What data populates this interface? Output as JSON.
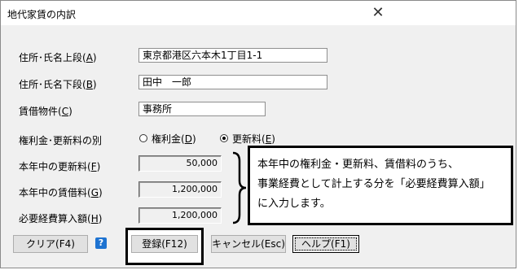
{
  "window": {
    "title": "地代家賃の内訳",
    "close_icon": "close-icon"
  },
  "fields": {
    "address_upper": {
      "label_pre": "住所･氏名上段(",
      "label_key": "A",
      "label_post": ")",
      "value": "東京都港区六本木1丁目1-1"
    },
    "address_lower": {
      "label_pre": "住所･氏名下段(",
      "label_key": "B",
      "label_post": ")",
      "value": "田中　一郎"
    },
    "property": {
      "label_pre": "賃借物件(",
      "label_key": "C",
      "label_post": ")",
      "value": "事務所"
    }
  },
  "type_choice": {
    "label": "権利金･更新料の別",
    "option1": {
      "pre": "権利金(",
      "key": "D",
      "post": ")",
      "selected": false
    },
    "option2": {
      "pre": "更新料(",
      "key": "E",
      "post": ")",
      "selected": true
    }
  },
  "amounts": {
    "renewal": {
      "label_pre": "本年中の更新料(",
      "label_key": "F",
      "label_post": ")",
      "value": "50,000"
    },
    "rent": {
      "label_pre": "本年中の賃借料(",
      "label_key": "G",
      "label_post": ")",
      "value": "1,200,000"
    },
    "expense": {
      "label_pre": "必要経費算入額(",
      "label_key": "H",
      "label_post": ")",
      "value": "1,200,000"
    }
  },
  "buttons": {
    "clear": "クリア(F4)",
    "help_icon": "?",
    "register": "登録(F12)",
    "cancel": "キャンセル(Esc)",
    "help": "ヘルプ(F1)"
  },
  "note": {
    "line1": "本年中の権利金・更新料、賃借料のうち、",
    "line2": "事業経費として計上する分を「必要経費算入額」",
    "line3": "に入力します。"
  }
}
